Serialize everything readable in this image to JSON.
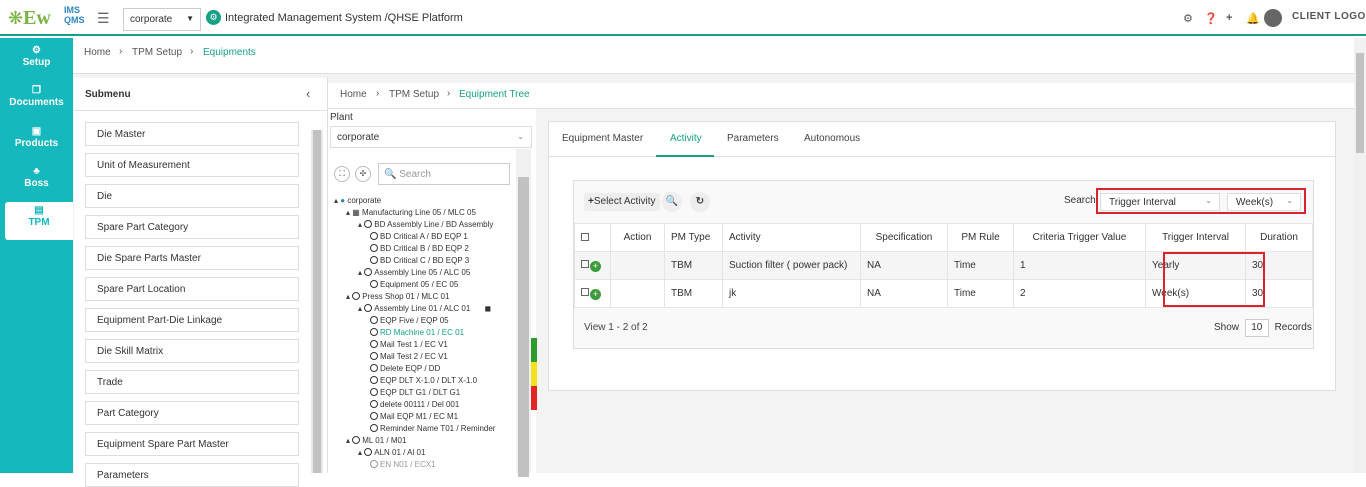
{
  "header": {
    "logo_main": "Ew",
    "logo_top": "IMS",
    "logo_bottom": "QMS",
    "company_select": "corporate",
    "app_title": "Integrated Management System /QHSE Platform",
    "client_logo": "CLIENT LOGO"
  },
  "sidebar": {
    "items": [
      {
        "label": "Setup",
        "icon": "gears-icon"
      },
      {
        "label": "Documents",
        "icon": "copy-icon"
      },
      {
        "label": "Products",
        "icon": "cube-icon"
      },
      {
        "label": "Boss",
        "icon": "sitemap-icon"
      },
      {
        "label": "TPM",
        "icon": "hdd-icon"
      }
    ]
  },
  "breadcrumb1": {
    "home": "Home",
    "section": "TPM Setup",
    "current": "Equipments"
  },
  "submenu": {
    "title": "Submenu",
    "items": [
      "Die Master",
      "Unit of Measurement",
      "Die",
      "Spare Part Category",
      "Die Spare Parts Master",
      "Spare Part Location",
      "Equipment Part-Die Linkage",
      "Die Skill Matrix",
      "Trade",
      "Part Category",
      "Equipment Spare Part Master",
      "Parameters"
    ]
  },
  "breadcrumb2": {
    "home": "Home",
    "section": "TPM Setup",
    "current": "Equipment Tree"
  },
  "plant": {
    "label": "Plant",
    "selected": "corporate",
    "search_placeholder": "Search"
  },
  "tree": [
    {
      "label": "corporate"
    },
    {
      "label": "Manufacturing Line 05 / MLC 05"
    },
    {
      "label": "BD Assembly Line / BD Assembly"
    },
    {
      "label": "BD Critical A / BD EQP 1"
    },
    {
      "label": "BD Critical B / BD EQP 2"
    },
    {
      "label": "BD Critical C / BD EQP 3"
    },
    {
      "label": "Assembly Line 05 / ALC 05"
    },
    {
      "label": "Equipment 05 / EC 05"
    },
    {
      "label": "Press Shop 01 / MLC 01"
    },
    {
      "label": "Assembly Line 01 / ALC 01"
    },
    {
      "label": "EQP Five / EQP 05"
    },
    {
      "label": "RD Machine 01 / EC 01"
    },
    {
      "label": "Mail Test 1 / EC V1"
    },
    {
      "label": "Mail Test 2 / EC V1"
    },
    {
      "label": "Delete EQP / DD"
    },
    {
      "label": "EQP DLT X-1.0 / DLT X-1.0"
    },
    {
      "label": "EQP DLT G1 / DLT G1"
    },
    {
      "label": "delete 00111 / Del 001"
    },
    {
      "label": "Mail EQP M1 / EC M1"
    },
    {
      "label": "Reminder Name T01 / Reminder"
    },
    {
      "label": "ML 01 / M01"
    },
    {
      "label": "ALN 01 / Al 01"
    },
    {
      "label": "EN N01 / ECX1"
    }
  ],
  "tabs": [
    "Equipment Master",
    "Activity",
    "Parameters",
    "Autonomous"
  ],
  "grid": {
    "select_activity": "Select Activity",
    "search_label": "Search",
    "filter_field": "Trigger Interval",
    "filter_value": "Week(s)",
    "columns": [
      "Action",
      "PM Type",
      "Activity",
      "Specification",
      "PM Rule",
      "Criteria Trigger Value",
      "Trigger Interval",
      "Duration"
    ],
    "rows": [
      {
        "pm_type": "TBM",
        "activity": "Suction filter ( power pack)",
        "specification": "NA",
        "pm_rule": "Time",
        "criteria": "1",
        "interval": "Yearly",
        "duration": "30"
      },
      {
        "pm_type": "TBM",
        "activity": "jk",
        "specification": "NA",
        "pm_rule": "Time",
        "criteria": "2",
        "interval": "Week(s)",
        "duration": "30"
      }
    ],
    "view_text": "View 1 - 2 of 2",
    "show_label": "Show",
    "page_size": "10",
    "records_label": "Records"
  },
  "colors": {
    "accent": "#16a085",
    "sidebar": "#14b8bd",
    "highlight": "#d9232d"
  }
}
